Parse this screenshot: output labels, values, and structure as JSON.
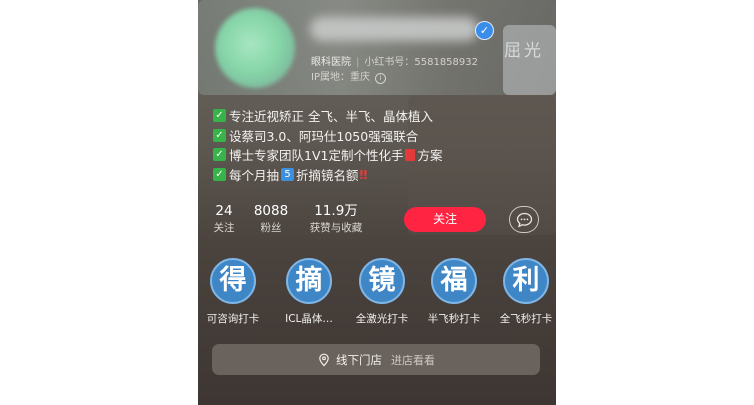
{
  "profile": {
    "category": "眼科医院",
    "rednote_id": "小红书号：5581858932",
    "ip_location": "IP属地：重庆",
    "info_icon": "info-icon"
  },
  "background": {
    "sign_text": "屈光"
  },
  "bio": [
    "专注近视矫正 全飞、半飞、晶体植入",
    "设蔡司3.0、阿玛仕1050强强联合",
    "博士专家团队1V1定制个性化手",
    "每个月抽"
  ],
  "bio_tail": {
    "line3_suffix": "方案",
    "line4_number": "5",
    "line4_suffix": "折摘镜名额"
  },
  "stats": [
    {
      "value": "24",
      "label": "关注"
    },
    {
      "value": "8088",
      "label": "粉丝"
    },
    {
      "value": "11.9万",
      "label": "获赞与收藏"
    }
  ],
  "actions": {
    "follow_label": "关注",
    "message_icon": "chat-bubble-icon"
  },
  "collections": [
    {
      "glyph": "得",
      "label": "可咨询打卡"
    },
    {
      "glyph": "摘",
      "label": "ICL晶体…"
    },
    {
      "glyph": "镜",
      "label": "全激光打卡"
    },
    {
      "glyph": "福",
      "label": "半飞秒打卡"
    },
    {
      "glyph": "利",
      "label": "全飞秒打卡"
    }
  ],
  "store": {
    "title": "线下门店",
    "subtitle": "进店看看",
    "icon": "location-pin-icon"
  },
  "colors": {
    "follow_bg": "#ff2442",
    "tile_blue": "#3f86c6",
    "check_green": "#38b34a"
  }
}
